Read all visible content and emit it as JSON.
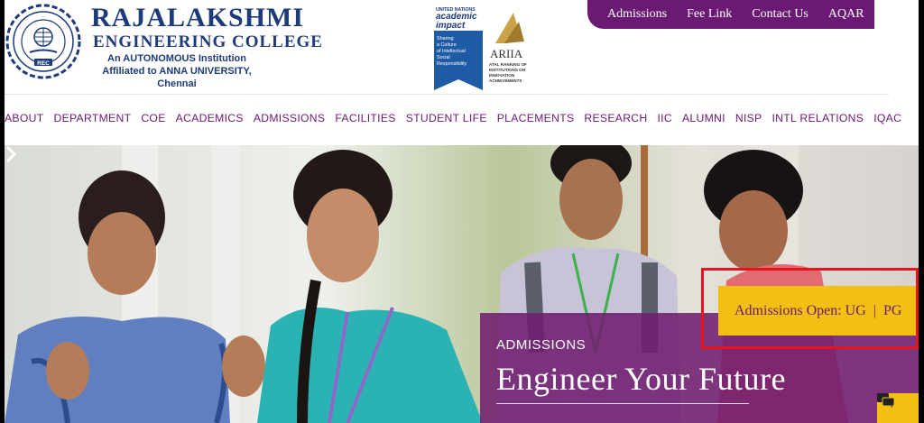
{
  "header": {
    "college_name": "RAJALAKSHMI",
    "college_sub": "ENGINEERING COLLEGE",
    "tagline_1": "An AUTONOMOUS Institution",
    "tagline_2": "Affiliated to ANNA UNIVERSITY, Chennai",
    "seal_icon": "rec-seal-logo",
    "un_badge_top": "UNITED NATIONS",
    "un_badge_brand_1": "academic",
    "un_badge_brand_2": "impact",
    "un_badge_text": [
      "Sharing",
      "a Culture",
      "of Intellectual",
      "Social",
      "Responsibility"
    ],
    "ariia_name": "ARIIA",
    "ariia_text": [
      "ATAL RANKING OF",
      "INSTITUTIONS ON",
      "INNOVATION",
      "ACHIEVEMENTS"
    ]
  },
  "top_links": [
    "Admissions",
    "Fee Link",
    "Contact Us",
    "AQAR"
  ],
  "nav": [
    "ABOUT",
    "DEPARTMENT",
    "COE",
    "ACADEMICS",
    "ADMISSIONS",
    "FACILITIES",
    "STUDENT LIFE",
    "PLACEMENTS",
    "RESEARCH",
    "IIC",
    "ALUMNI",
    "NISP",
    "INTL RELATIONS",
    "IQAC"
  ],
  "hero": {
    "kicker": "ADMISSIONS",
    "title": "Engineer Your Future",
    "admissions_open": "Admissions Open: UG  |  PG",
    "next_icon": "chevron-right-icon",
    "chat_icon": "chat-icon"
  },
  "colors": {
    "brand_purple": "#6b1a73",
    "brand_navy": "#1d3a7a",
    "accent_yellow": "#f3bf12",
    "highlight_red": "#e8141c"
  }
}
